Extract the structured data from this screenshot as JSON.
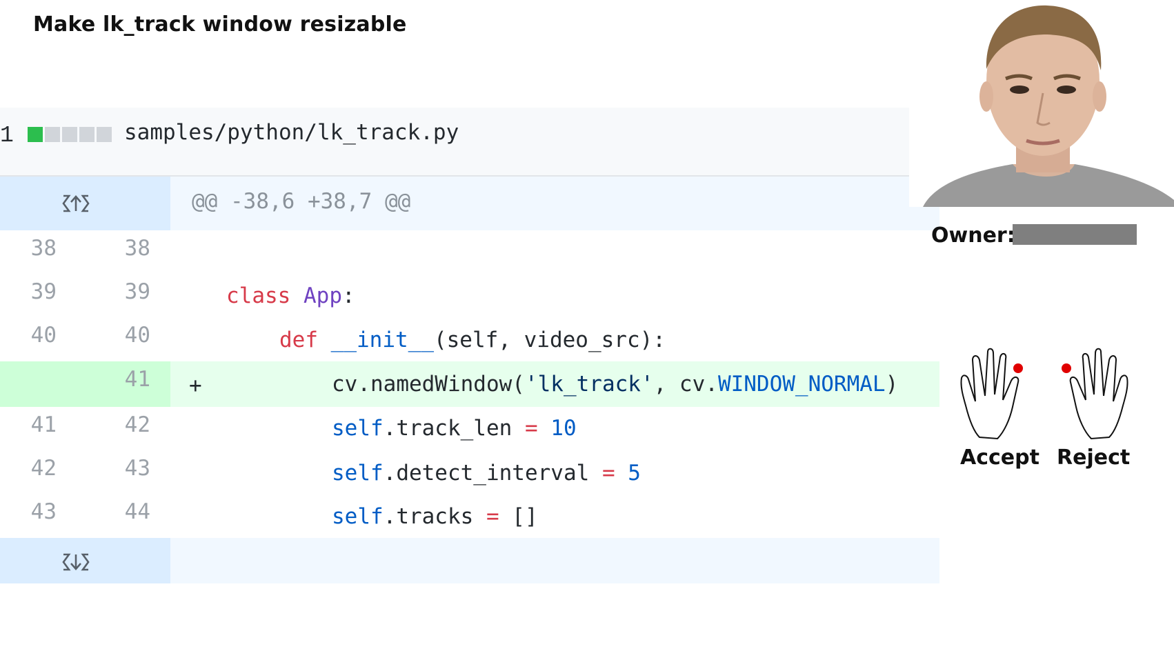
{
  "title": "Make lk_track window resizable",
  "file": {
    "changes": "1",
    "diffstat": [
      "added",
      "neutral",
      "neutral",
      "neutral",
      "neutral"
    ],
    "colors": {
      "added": "#2cbe4e",
      "neutral": "#d1d5da"
    },
    "path": "samples/python/lk_track.py"
  },
  "diff": {
    "hunk_header": "@@ -38,6 +38,7 @@",
    "expand_up_icon": "expand-up-icon",
    "expand_down_icon": "expand-down-icon",
    "lines": [
      {
        "old": "38",
        "new": "38",
        "marker": "",
        "type": "context"
      },
      {
        "old": "39",
        "new": "39",
        "marker": "",
        "type": "context"
      },
      {
        "old": "40",
        "new": "40",
        "marker": "",
        "type": "context"
      },
      {
        "old": "",
        "new": "41",
        "marker": "+",
        "type": "added"
      },
      {
        "old": "41",
        "new": "42",
        "marker": "",
        "type": "context"
      },
      {
        "old": "42",
        "new": "43",
        "marker": "",
        "type": "context"
      },
      {
        "old": "43",
        "new": "44",
        "marker": "",
        "type": "context"
      }
    ],
    "code": {
      "l39_kw": "class",
      "l39_name": "App",
      "l39_colon": ":",
      "l40_kw": "def",
      "l40_fn": "__init__",
      "l40_rest": "(self, video_src):",
      "l41_a": "cv.namedWindow(",
      "l41_str": "'lk_track'",
      "l41_b": ", cv.",
      "l41_const": "WINDOW_NORMAL",
      "l41_c": ")",
      "l42_self": "self",
      "l42_attr": ".track_len ",
      "l42_op": "=",
      "l42_val": " 10",
      "l43_self": "self",
      "l43_attr": ".detect_interval ",
      "l43_op": "=",
      "l43_val": " 5",
      "l44_self": "self",
      "l44_attr": ".tracks ",
      "l44_op": "=",
      "l44_val": " []"
    }
  },
  "owner": {
    "label": "Owner:",
    "redacted_color": "#7f7f7f"
  },
  "gestures": {
    "accept_label": "Accept",
    "reject_label": "Reject",
    "accept_icon": "left-hand-icon",
    "reject_icon": "right-hand-icon",
    "marker_color": "#e00000"
  }
}
